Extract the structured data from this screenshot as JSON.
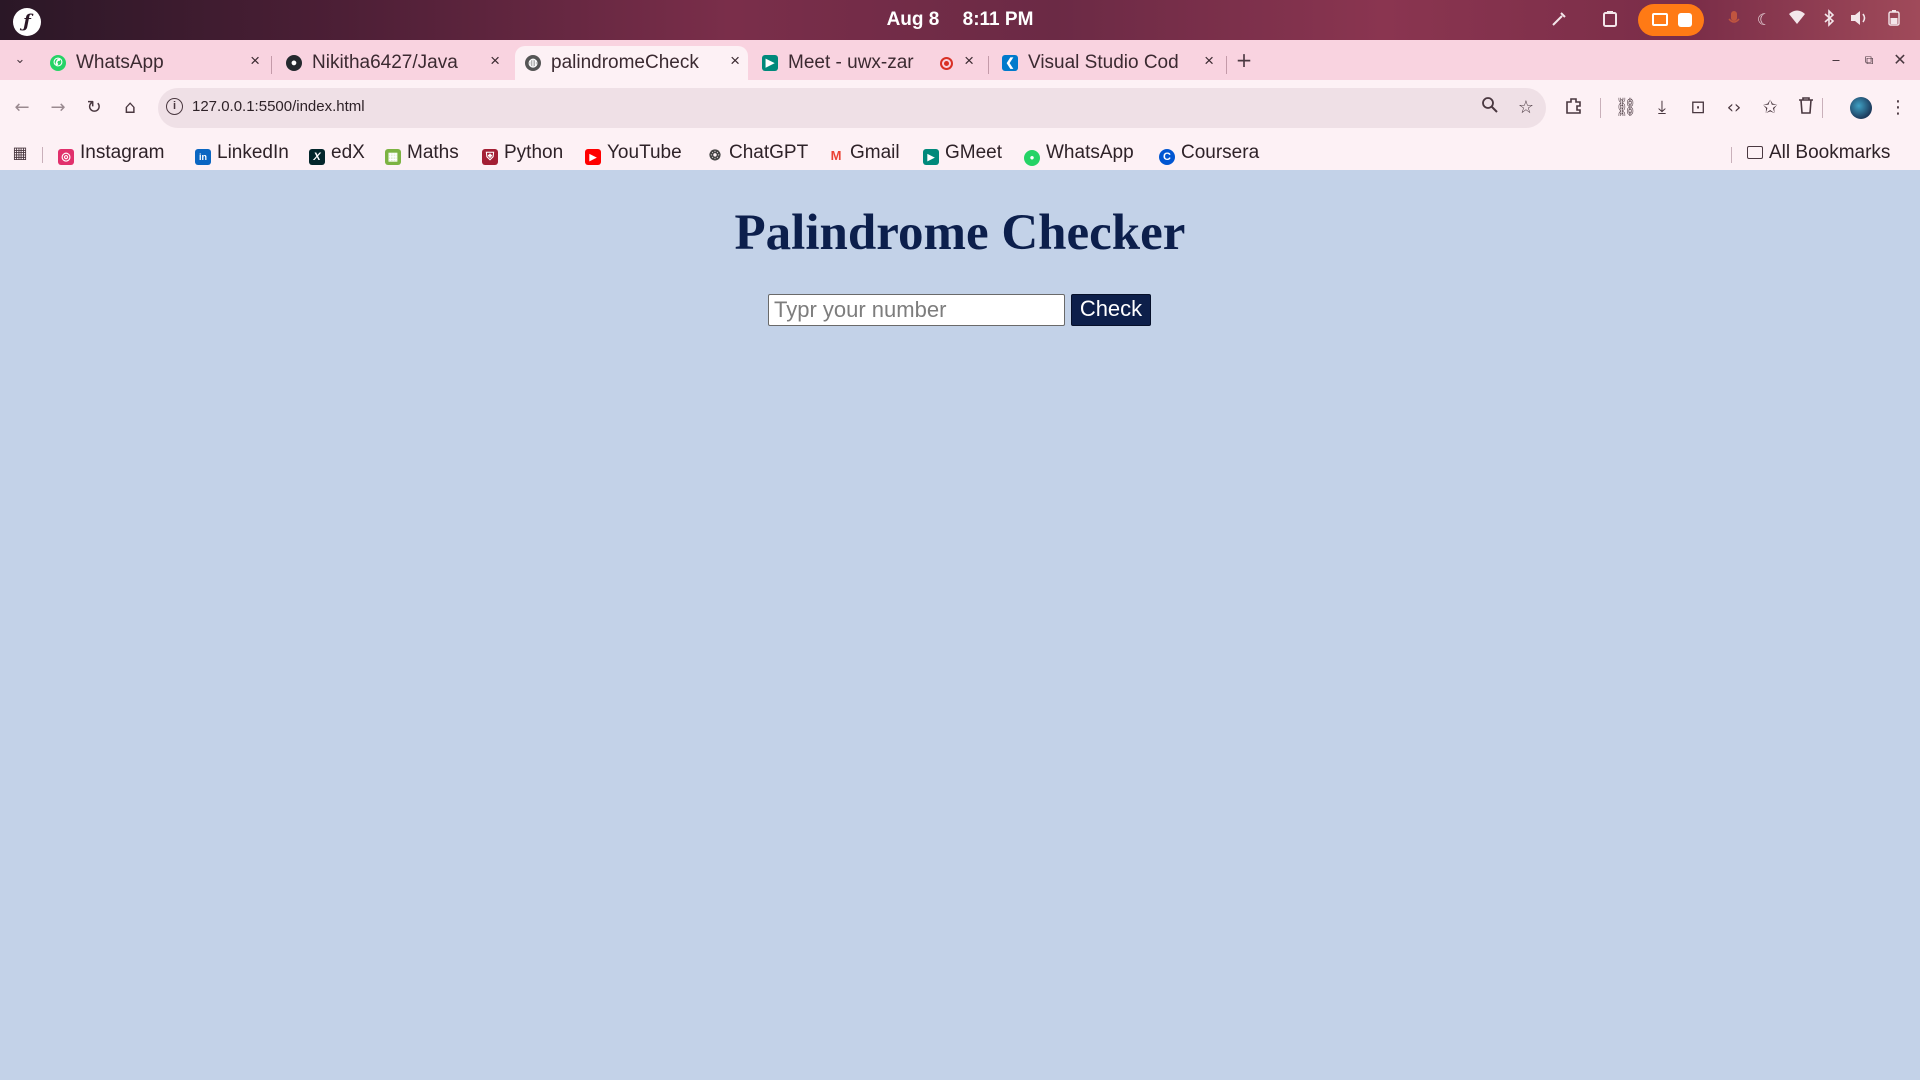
{
  "topbar": {
    "date": "Aug 8",
    "time": "8:11 PM",
    "logo": "ƒ",
    "icons": [
      "color-picker-icon",
      "clipboard-icon",
      "screen-record-icon",
      "microphone-icon",
      "night-light-icon",
      "wifi-icon",
      "bluetooth-icon",
      "volume-icon",
      "battery-icon"
    ]
  },
  "tabs": [
    {
      "title": "WhatsApp",
      "favicon": "whatsapp-icon",
      "color": "#25d366",
      "active": false
    },
    {
      "title": "Nikitha6427/Java",
      "favicon": "github-icon",
      "color": "#24292e",
      "active": false
    },
    {
      "title": "palindromeCheck",
      "favicon": "globe-icon",
      "color": "#555555",
      "active": true
    },
    {
      "title": "Meet - uwx-zar",
      "favicon": "google-meet-icon",
      "color": "#00897b",
      "active": false
    },
    {
      "title": "Visual Studio Cod",
      "favicon": "vscode-icon",
      "color": "#007acc",
      "active": false
    }
  ],
  "toolbar": {
    "url": "127.0.0.1:5500/index.html",
    "new_tab": "+",
    "close_tab": "×"
  },
  "bookmarks": [
    {
      "label": "Instagram",
      "color": "#e1306c",
      "glyph": "◎"
    },
    {
      "label": "LinkedIn",
      "color": "#0a66c2",
      "glyph": "in"
    },
    {
      "label": "edX",
      "color": "#02262b",
      "glyph": "X"
    },
    {
      "label": "Maths",
      "color": "#7cb342",
      "glyph": "▦"
    },
    {
      "label": "Python",
      "color": "#a31f34",
      "glyph": "⛨"
    },
    {
      "label": "YouTube",
      "color": "#ff0000",
      "glyph": "▶"
    },
    {
      "label": "ChatGPT",
      "color": "#444444",
      "glyph": "❂"
    },
    {
      "label": "Gmail",
      "color": "#ea4335",
      "glyph": "M"
    },
    {
      "label": "GMeet",
      "color": "#00897b",
      "glyph": "▶"
    },
    {
      "label": "WhatsApp",
      "color": "#25d366",
      "glyph": "●"
    },
    {
      "label": "Coursera",
      "color": "#0056d2",
      "glyph": "C"
    }
  ],
  "all_bookmarks": "All Bookmarks",
  "page": {
    "title": "Palindrome Checker",
    "input_placeholder": "Typr your number",
    "input_value": "",
    "button_label": "Check",
    "background": "#c3d2e8",
    "title_color": "#0c1f4c",
    "button_color": "#0d1f4a"
  }
}
